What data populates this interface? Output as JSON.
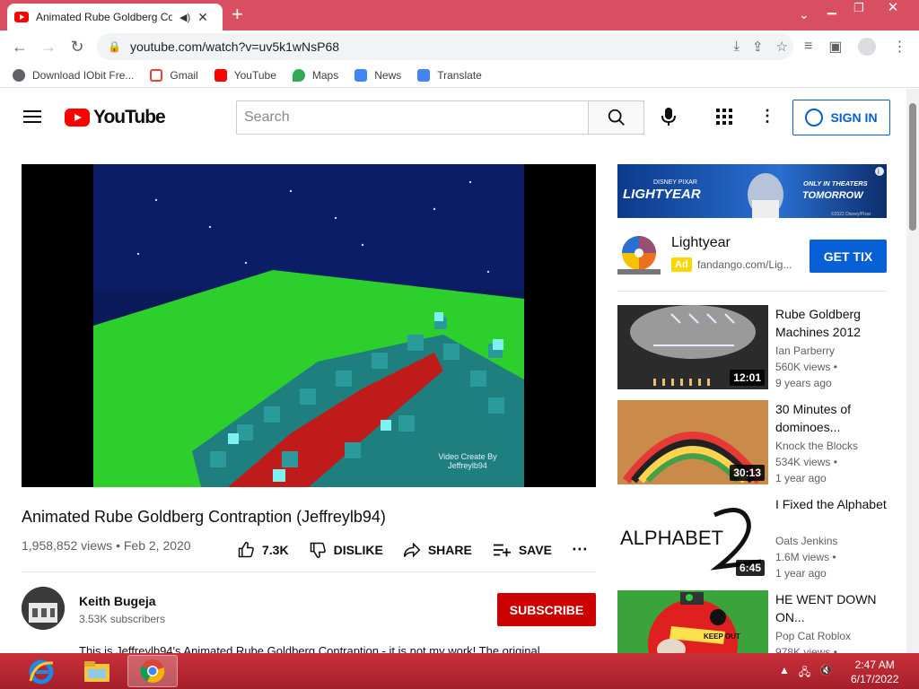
{
  "browser": {
    "tab_title": "Animated Rube Goldberg Co",
    "url": "youtube.com/watch?v=uv5k1wNsP68",
    "bookmarks": [
      "Download IObit Fre...",
      "Gmail",
      "YouTube",
      "Maps",
      "News",
      "Translate"
    ]
  },
  "youtube": {
    "logo_text": "YouTube",
    "search_placeholder": "Search",
    "sign_in": "SIGN IN"
  },
  "video": {
    "watermark_line1": "Video Create By",
    "watermark_line2": "Jeffreylb94",
    "title": "Animated Rube Goldberg Contraption (Jeffreylb94)",
    "meta": "1,958,852 views • Feb 2, 2020",
    "likes": "7.3K",
    "dislike": "DISLIKE",
    "share": "SHARE",
    "save": "SAVE",
    "channel": "Keith Bugeja",
    "subscribers": "3.53K subscribers",
    "subscribe": "SUBSCRIBE",
    "description": "This is Jeffreylb94's Animated Rube Goldberg Contraption - it is not my work! The original"
  },
  "ad": {
    "banner_brand": "DISNEY PIXAR",
    "banner_title": "LIGHTYEAR",
    "banner_tag1": "ONLY IN THEATERS",
    "banner_tag2": "TOMORROW",
    "banner_copy": "©2022 Disney/Pixar",
    "name": "Lightyear",
    "badge": "Ad",
    "url": "fandango.com/Lig...",
    "cta": "GET TIX"
  },
  "recommendations": [
    {
      "title": "Rube Goldberg Machines 2012",
      "channel": "Ian Parberry",
      "views": "560K views •",
      "age": "9 years ago",
      "duration": "12:01"
    },
    {
      "title": "30 Minutes of dominoes...",
      "channel": "Knock the Blocks",
      "views": "534K views •",
      "age": "1 year ago",
      "duration": "30:13"
    },
    {
      "title": "I Fixed the Alphabet",
      "channel": "Oats Jenkins",
      "views": "1.6M views •",
      "age": "1 year ago",
      "duration": "6:45",
      "thumb_text": "ALPHABET"
    },
    {
      "title": "HE WENT DOWN ON...",
      "channel": "Pop Cat Roblox",
      "views": "978K views •",
      "age": "",
      "duration": "",
      "thumb_text": "KEEP OUT"
    }
  ],
  "taskbar": {
    "time": "2:47 AM",
    "date": "6/17/2022"
  },
  "colors": {
    "chrome_frame": "#d94f62",
    "youtube_red": "#ff0000",
    "link_blue": "#065fd4",
    "subscribe_red": "#cc0000",
    "taskbar": "#b72632"
  }
}
